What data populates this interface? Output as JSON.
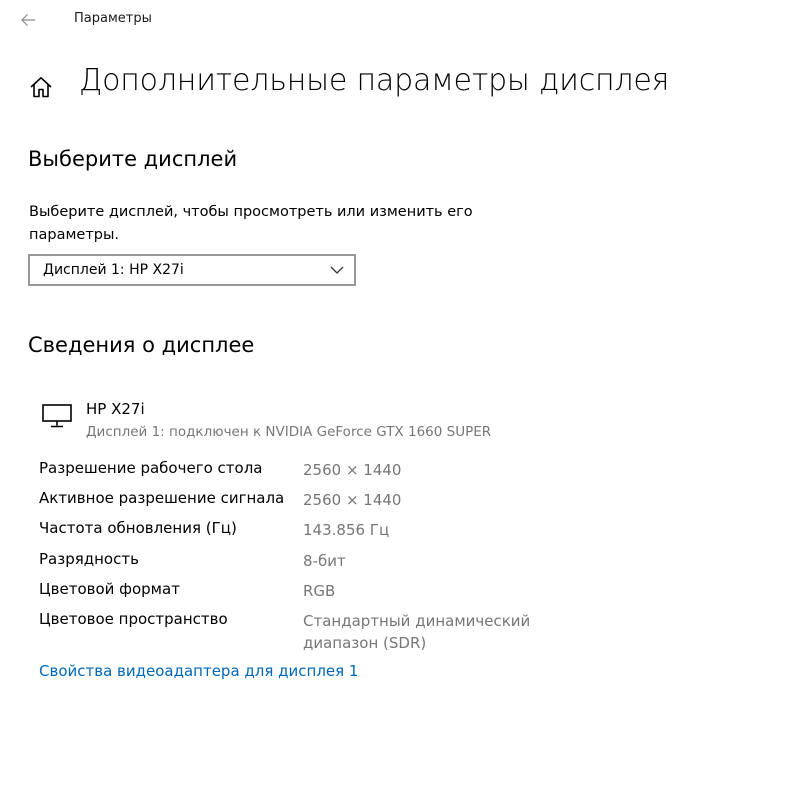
{
  "window": {
    "title": "Параметры"
  },
  "page": {
    "title": "Дополнительные параметры дисплея"
  },
  "select_section": {
    "heading": "Выберите дисплей",
    "description": "Выберите дисплей, чтобы просмотреть или изменить его параметры.",
    "dropdown_value": "Дисплей 1: HP X27i"
  },
  "info_section": {
    "heading": "Сведения о дисплее",
    "display_name": "HP X27i",
    "display_subtitle": "Дисплей 1: подключен к NVIDIA GeForce GTX 1660 SUPER",
    "rows": [
      {
        "label": "Разрешение рабочего стола",
        "value": "2560 × 1440"
      },
      {
        "label": "Активное разрешение сигнала",
        "value": "2560 × 1440"
      },
      {
        "label": "Частота обновления (Гц)",
        "value": "143.856 Гц"
      },
      {
        "label": "Разрядность",
        "value": "8-бит"
      },
      {
        "label": "Цветовой формат",
        "value": "RGB"
      },
      {
        "label": "Цветовое пространство",
        "value": "Стандартный динамический диапазон (SDR)"
      }
    ],
    "adapter_link": "Свойства видеоадаптера для дисплея 1"
  },
  "icons": {
    "back": "back-arrow-icon",
    "home": "home-icon",
    "dropdown": "chevron-down-icon",
    "monitor": "monitor-icon"
  },
  "colors": {
    "link": "#0067b8",
    "secondary_text": "#767676",
    "border": "#999999"
  }
}
